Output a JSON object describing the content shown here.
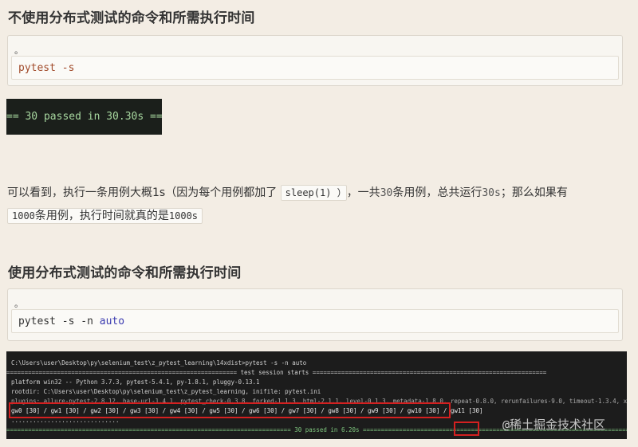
{
  "heading1": "不使用分布式测试的命令和所需执行时间",
  "code1": {
    "lang": "。",
    "prefix": "pytest ",
    "flag": "-s"
  },
  "result1": "== 30 passed in 30.30s ==",
  "paragraph": {
    "t1": "可以看到，执行一条用例大概1s（因为每个用例都加了 ",
    "c1": "sleep(1) ）",
    "t2": "，一共",
    "n1": "30",
    "t3": "条用例，总共运行",
    "n2": "30s",
    "t4": "；那么如果有",
    "c2_num": "1000",
    "t5": "条用例，执行时间就真的是",
    "c2_time": "1000s"
  },
  "heading2": "使用分布式测试的命令和所需执行时间",
  "code2": {
    "lang": "。",
    "prefix": "pytest -s -n ",
    "arg": "auto"
  },
  "terminal": {
    "cmd": "C:\\Users\\user\\Desktop\\py\\selenium_test\\z_pytest_learning\\14xdist>pytest -s -n auto",
    "session": "================================================================ test session starts =================================================================",
    "platform": "platform win32 -- Python 3.7.3, pytest-5.4.1, py-1.8.1, pluggy-0.13.1",
    "rootdir": "rootdir: C:\\Users\\user\\Desktop\\py\\selenium_test\\z_pytest_learning, inifile: pytest.ini",
    "plugins": "plugins: allure-pytest-2.8.12, base-url-1.4.1, pytest_check-0.3.8, forked-1.1.3, html-2.1.1, level-0.1.3, metadata-1.8.0, repeat-0.8.0, rerunfailures-9.0, timeout-1.3.4, xdist-1.31.0",
    "workers": "gw0 [30] / gw1 [30] / gw2 [30] / gw3 [30] / gw4 [30] / gw5 [30] / gw6 [30] / gw7 [30] / gw8 [30] / gw9 [30] / gw10 [30] / gw11 [30]",
    "dots": "..............................",
    "summary_prefix": "=============================================================================== 30 passed in ",
    "summary_time": "6.20s",
    "summary_suffix": " =========================================================================="
  },
  "watermark": "@稀土掘金技术社区"
}
